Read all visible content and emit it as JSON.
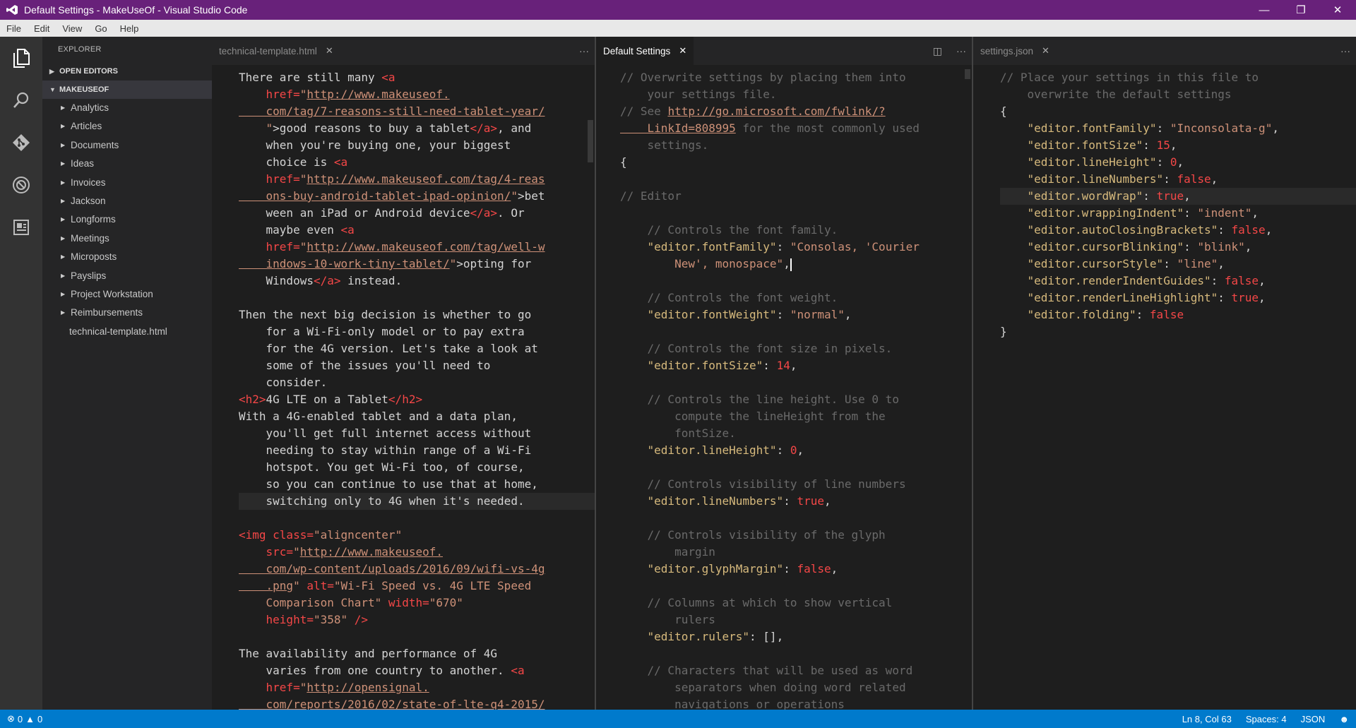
{
  "window": {
    "title": "Default Settings - MakeUseOf - Visual Studio Code",
    "controls": {
      "minimize": "—",
      "maximize": "❐",
      "close": "✕"
    }
  },
  "menu": [
    "File",
    "Edit",
    "View",
    "Go",
    "Help"
  ],
  "activity_bar": [
    {
      "name": "explorer-icon"
    },
    {
      "name": "search-icon"
    },
    {
      "name": "git-icon"
    },
    {
      "name": "debug-icon"
    },
    {
      "name": "extensions-icon"
    }
  ],
  "sidebar": {
    "title": "EXPLORER",
    "open_editors": "OPEN EDITORS",
    "folder": "MAKEUSEOF",
    "items": [
      "Analytics",
      "Articles",
      "Documents",
      "Ideas",
      "Invoices",
      "Jackson",
      "Longforms",
      "Meetings",
      "Microposts",
      "Payslips",
      "Project Workstation",
      "Reimbursements"
    ],
    "file": "technical-template.html"
  },
  "editors": {
    "left": {
      "tab": "technical-template.html",
      "lines": [
        [
          [
            "There are still many ",
            "txt"
          ],
          [
            "<a",
            "tag"
          ]
        ],
        [
          [
            "    href=",
            "attr"
          ],
          [
            "\"",
            "str"
          ],
          [
            "http://www.makeuseof.",
            "url"
          ]
        ],
        [
          [
            "    com/tag/7-reasons-still-need-tablet-year/",
            "url"
          ]
        ],
        [
          [
            "    \"",
            "str"
          ],
          [
            ">good reasons to buy a tablet",
            "txt"
          ],
          [
            "</a>",
            "tag"
          ],
          [
            ", and",
            "txt"
          ]
        ],
        [
          [
            "    when you're buying one, your biggest",
            "txt"
          ]
        ],
        [
          [
            "    choice is ",
            "txt"
          ],
          [
            "<a",
            "tag"
          ]
        ],
        [
          [
            "    href=",
            "attr"
          ],
          [
            "\"",
            "str"
          ],
          [
            "http://www.makeuseof.com/tag/4-reas",
            "url"
          ]
        ],
        [
          [
            "    ons-buy-android-tablet-ipad-opinion/",
            "url"
          ],
          [
            "\"",
            "str"
          ],
          [
            ">bet",
            "txt"
          ]
        ],
        [
          [
            "    ween an iPad or Android device",
            "txt"
          ],
          [
            "</a>",
            "tag"
          ],
          [
            ". Or",
            "txt"
          ]
        ],
        [
          [
            "    maybe even ",
            "txt"
          ],
          [
            "<a",
            "tag"
          ]
        ],
        [
          [
            "    href=",
            "attr"
          ],
          [
            "\"",
            "str"
          ],
          [
            "http://www.makeuseof.com/tag/well-w",
            "url"
          ]
        ],
        [
          [
            "    indows-10-work-tiny-tablet/",
            "url"
          ],
          [
            "\"",
            "str"
          ],
          [
            ">opting for",
            "txt"
          ]
        ],
        [
          [
            "    Windows",
            "txt"
          ],
          [
            "</a>",
            "tag"
          ],
          [
            " instead.",
            "txt"
          ]
        ],
        [
          [
            "",
            "txt"
          ]
        ],
        [
          [
            "Then the next big decision is whether to go",
            "txt"
          ]
        ],
        [
          [
            "    for a Wi-Fi-only model or to pay extra",
            "txt"
          ]
        ],
        [
          [
            "    for the 4G version. Let's take a look at",
            "txt"
          ]
        ],
        [
          [
            "    some of the issues you'll need to",
            "txt"
          ]
        ],
        [
          [
            "    consider.",
            "txt"
          ]
        ],
        [
          [
            "<h2>",
            "tag"
          ],
          [
            "4G LTE on a Tablet",
            "txt"
          ],
          [
            "</h2>",
            "tag"
          ]
        ],
        [
          [
            "With a 4G-enabled tablet and a data plan,",
            "txt"
          ]
        ],
        [
          [
            "    you'll get full internet access without",
            "txt"
          ]
        ],
        [
          [
            "    needing to stay within range of a Wi-Fi",
            "txt"
          ]
        ],
        [
          [
            "    hotspot. You get Wi-Fi too, of course,",
            "txt"
          ]
        ],
        [
          [
            "    so you can continue to use that at home,",
            "txt"
          ]
        ],
        [
          [
            "    switching only to 4G when it's needed.",
            "txt"
          ]
        ],
        [
          [
            "",
            "txt"
          ]
        ],
        [
          [
            "<img class=",
            "tag"
          ],
          [
            "\"aligncenter\"",
            "str"
          ]
        ],
        [
          [
            "    src=",
            "attr"
          ],
          [
            "\"",
            "str"
          ],
          [
            "http://www.makeuseof.",
            "url"
          ]
        ],
        [
          [
            "    com/wp-content/uploads/2016/09/wifi-vs-4g",
            "url"
          ]
        ],
        [
          [
            "    .png",
            "url"
          ],
          [
            "\" ",
            "str"
          ],
          [
            "alt=",
            "attr"
          ],
          [
            "\"Wi-Fi Speed vs. 4G LTE Speed",
            "str"
          ]
        ],
        [
          [
            "    Comparison Chart\" ",
            "str"
          ],
          [
            "width=",
            "attr"
          ],
          [
            "\"670\"",
            "str"
          ]
        ],
        [
          [
            "    height=",
            "attr"
          ],
          [
            "\"358\"",
            "str"
          ],
          [
            " />",
            "tag"
          ]
        ],
        [
          [
            "",
            "txt"
          ]
        ],
        [
          [
            "The availability and performance of 4G",
            "txt"
          ]
        ],
        [
          [
            "    varies from one country to another. ",
            "txt"
          ],
          [
            "<a",
            "tag"
          ]
        ],
        [
          [
            "    href=",
            "attr"
          ],
          [
            "\"",
            "str"
          ],
          [
            "http://opensignal.",
            "url"
          ]
        ],
        [
          [
            "    com/reports/2016/02/state-of-lte-q4-2015/",
            "url"
          ]
        ]
      ]
    },
    "middle": {
      "tab": "Default Settings",
      "lines": [
        [
          [
            "// Overwrite settings by placing them into",
            "com"
          ]
        ],
        [
          [
            "    your settings file.",
            "com"
          ]
        ],
        [
          [
            "// See ",
            "com"
          ],
          [
            "http://go.microsoft.com/fwlink/?",
            "url"
          ]
        ],
        [
          [
            "    LinkId=808995",
            "url"
          ],
          [
            " for the most commonly used",
            "com"
          ]
        ],
        [
          [
            "    settings.",
            "com"
          ]
        ],
        [
          [
            "{",
            "txt"
          ]
        ],
        [
          [
            "",
            "txt"
          ]
        ],
        [
          [
            "// Editor",
            "com"
          ]
        ],
        [
          [
            "",
            "txt"
          ]
        ],
        [
          [
            "    // Controls the font family.",
            "com"
          ]
        ],
        [
          [
            "    \"editor.fontFamily\"",
            "key"
          ],
          [
            ": ",
            "txt"
          ],
          [
            "\"Consolas, 'Courier",
            "str"
          ]
        ],
        [
          [
            "        New', monospace\"",
            "str"
          ],
          [
            ",",
            "txt"
          ]
        ],
        [
          [
            "",
            "txt"
          ]
        ],
        [
          [
            "    // Controls the font weight.",
            "com"
          ]
        ],
        [
          [
            "    \"editor.fontWeight\"",
            "key"
          ],
          [
            ": ",
            "txt"
          ],
          [
            "\"normal\"",
            "str"
          ],
          [
            ",",
            "txt"
          ]
        ],
        [
          [
            "",
            "txt"
          ]
        ],
        [
          [
            "    // Controls the font size in pixels.",
            "com"
          ]
        ],
        [
          [
            "    \"editor.fontSize\"",
            "key"
          ],
          [
            ": ",
            "txt"
          ],
          [
            "14",
            "num"
          ],
          [
            ",",
            "txt"
          ]
        ],
        [
          [
            "",
            "txt"
          ]
        ],
        [
          [
            "    // Controls the line height. Use 0 to",
            "com"
          ]
        ],
        [
          [
            "        compute the lineHeight from the",
            "com"
          ]
        ],
        [
          [
            "        fontSize.",
            "com"
          ]
        ],
        [
          [
            "    \"editor.lineHeight\"",
            "key"
          ],
          [
            ": ",
            "txt"
          ],
          [
            "0",
            "num"
          ],
          [
            ",",
            "txt"
          ]
        ],
        [
          [
            "",
            "txt"
          ]
        ],
        [
          [
            "    // Controls visibility of line numbers",
            "com"
          ]
        ],
        [
          [
            "    \"editor.lineNumbers\"",
            "key"
          ],
          [
            ": ",
            "txt"
          ],
          [
            "true",
            "kw"
          ],
          [
            ",",
            "txt"
          ]
        ],
        [
          [
            "",
            "txt"
          ]
        ],
        [
          [
            "    // Controls visibility of the glyph",
            "com"
          ]
        ],
        [
          [
            "        margin",
            "com"
          ]
        ],
        [
          [
            "    \"editor.glyphMargin\"",
            "key"
          ],
          [
            ": ",
            "txt"
          ],
          [
            "false",
            "kw"
          ],
          [
            ",",
            "txt"
          ]
        ],
        [
          [
            "",
            "txt"
          ]
        ],
        [
          [
            "    // Columns at which to show vertical",
            "com"
          ]
        ],
        [
          [
            "        rulers",
            "com"
          ]
        ],
        [
          [
            "    \"editor.rulers\"",
            "key"
          ],
          [
            ": ",
            "txt"
          ],
          [
            "[]",
            "txt"
          ],
          [
            ",",
            "txt"
          ]
        ],
        [
          [
            "",
            "txt"
          ]
        ],
        [
          [
            "    // Characters that will be used as word",
            "com"
          ]
        ],
        [
          [
            "        separators when doing word related",
            "com"
          ]
        ],
        [
          [
            "        navigations or operations",
            "com"
          ]
        ]
      ]
    },
    "right": {
      "tab": "settings.json",
      "lines": [
        [
          [
            "// Place your settings in this file to",
            "com"
          ]
        ],
        [
          [
            "    overwrite the default settings",
            "com"
          ]
        ],
        [
          [
            "{",
            "txt"
          ]
        ],
        [
          [
            "    \"editor.fontFamily\"",
            "key"
          ],
          [
            ": ",
            "txt"
          ],
          [
            "\"Inconsolata-g\"",
            "str"
          ],
          [
            ",",
            "txt"
          ]
        ],
        [
          [
            "    \"editor.fontSize\"",
            "key"
          ],
          [
            ": ",
            "txt"
          ],
          [
            "15",
            "num"
          ],
          [
            ",",
            "txt"
          ]
        ],
        [
          [
            "    \"editor.lineHeight\"",
            "key"
          ],
          [
            ": ",
            "txt"
          ],
          [
            "0",
            "num"
          ],
          [
            ",",
            "txt"
          ]
        ],
        [
          [
            "    \"editor.lineNumbers\"",
            "key"
          ],
          [
            ": ",
            "txt"
          ],
          [
            "false",
            "kw"
          ],
          [
            ",",
            "txt"
          ]
        ],
        [
          [
            "    \"editor.wordWrap\"",
            "key"
          ],
          [
            ": ",
            "txt"
          ],
          [
            "true",
            "kw"
          ],
          [
            ",",
            "txt"
          ]
        ],
        [
          [
            "    \"editor.wrappingIndent\"",
            "key"
          ],
          [
            ": ",
            "txt"
          ],
          [
            "\"indent\"",
            "str"
          ],
          [
            ",",
            "txt"
          ]
        ],
        [
          [
            "    \"editor.autoClosingBrackets\"",
            "key"
          ],
          [
            ": ",
            "txt"
          ],
          [
            "false",
            "kw"
          ],
          [
            ",",
            "txt"
          ]
        ],
        [
          [
            "    \"editor.cursorBlinking\"",
            "key"
          ],
          [
            ": ",
            "txt"
          ],
          [
            "\"blink\"",
            "str"
          ],
          [
            ",",
            "txt"
          ]
        ],
        [
          [
            "    \"editor.cursorStyle\"",
            "key"
          ],
          [
            ": ",
            "txt"
          ],
          [
            "\"line\"",
            "str"
          ],
          [
            ",",
            "txt"
          ]
        ],
        [
          [
            "    \"editor.renderIndentGuides\"",
            "key"
          ],
          [
            ": ",
            "txt"
          ],
          [
            "false",
            "kw"
          ],
          [
            ",",
            "txt"
          ]
        ],
        [
          [
            "    \"editor.renderLineHighlight\"",
            "key"
          ],
          [
            ": ",
            "txt"
          ],
          [
            "true",
            "kw"
          ],
          [
            ",",
            "txt"
          ]
        ],
        [
          [
            "    \"editor.folding\"",
            "key"
          ],
          [
            ": ",
            "txt"
          ],
          [
            "false",
            "kw"
          ]
        ],
        [
          [
            "}",
            "txt"
          ]
        ]
      ]
    }
  },
  "statusbar": {
    "errors": "0",
    "warnings": "0",
    "position": "Ln 8, Col 63",
    "spaces": "Spaces: 4",
    "language": "JSON"
  },
  "colors": {
    "title_bar": "#68217a",
    "status_bar": "#007acc",
    "editor_bg": "#1e1e1e",
    "tag": "#f44747",
    "string": "#ce9178",
    "key": "#d7ba7d",
    "comment": "#6a6a6a"
  }
}
